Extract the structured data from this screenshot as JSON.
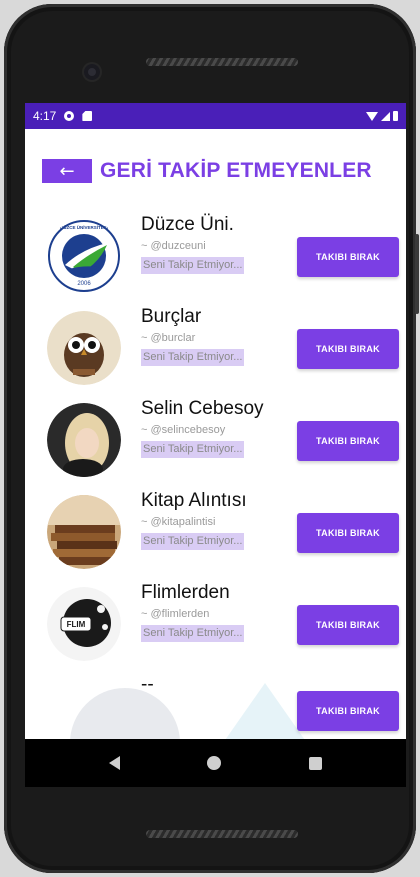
{
  "status_bar": {
    "time": "4:17"
  },
  "header": {
    "back_icon": "←",
    "title": "GERİ TAKİP ETMEYENLER"
  },
  "users": [
    {
      "name": "Düzce Üni.",
      "handle": "~ @duzceuni",
      "note": "Seni Takip Etmiyor...",
      "button": "TAKIBI BIRAK",
      "logo_text": "DÜZCE ÜNİVERSİTESİ",
      "logo_year": "2006"
    },
    {
      "name": "Burçlar",
      "handle": "~ @burclar",
      "note": "Seni Takip Etmiyor...",
      "button": "TAKIBI BIRAK"
    },
    {
      "name": "Selin Cebesoy",
      "handle": "~ @selincebesoy",
      "note": "Seni Takip Etmiyor...",
      "button": "TAKIBI BIRAK"
    },
    {
      "name": "Kitap Alıntısı",
      "handle": "~ @kitapalintisi",
      "note": "Seni Takip Etmiyor...",
      "button": "TAKIBI BIRAK"
    },
    {
      "name": "Flimlerden",
      "handle": "~ @flimlerden",
      "note": "Seni Takip Etmiyor...",
      "button": "TAKIBI BIRAK",
      "logo_text": "FLIM"
    },
    {
      "name": "--",
      "handle": "",
      "note": "",
      "button": "TAKIBI BIRAK"
    }
  ],
  "colors": {
    "accent": "#7b3fe4",
    "status_bar": "#4a1fb8",
    "note_bg": "#d9ccf4"
  },
  "icons": {
    "back": "arrow-left-icon",
    "settings": "gear-icon",
    "sd": "sd-card-icon",
    "wifi": "wifi-icon",
    "signal": "signal-icon",
    "battery": "battery-icon"
  }
}
